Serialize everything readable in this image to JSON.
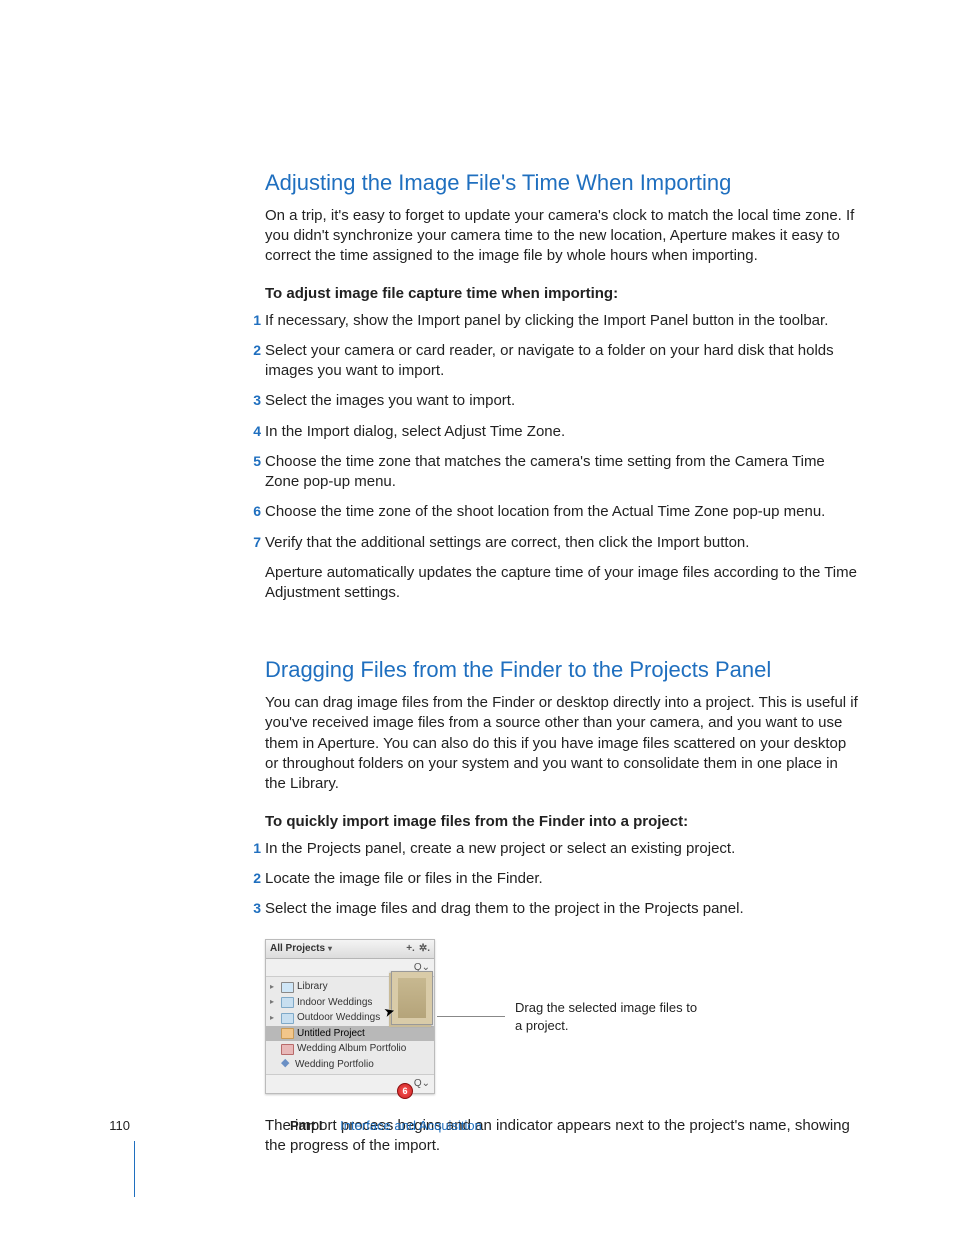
{
  "section1": {
    "heading": "Adjusting the Image File's Time When Importing",
    "intro": "On a trip, it's easy to forget to update your camera's clock to match the local time zone. If you didn't synchronize your camera time to the new location, Aperture makes it easy to correct the time assigned to the image file by whole hours when importing.",
    "lead": "To adjust image file capture time when importing:",
    "steps": [
      "If necessary, show the Import panel by clicking the Import Panel button in the toolbar.",
      "Select your camera or card reader, or navigate to a folder on your hard disk that holds images you want to import.",
      "Select the images you want to import.",
      "In the Import dialog, select Adjust Time Zone.",
      "Choose the time zone that matches the camera's time setting from the Camera Time Zone pop-up menu.",
      "Choose the time zone of the shoot location from the Actual Time Zone pop-up menu.",
      "Verify that the additional settings are correct, then click the Import button."
    ],
    "outro": "Aperture automatically updates the capture time of your image files according to the Time Adjustment settings."
  },
  "section2": {
    "heading": "Dragging Files from the Finder to the Projects Panel",
    "intro": "You can drag image files from the Finder or desktop directly into a project. This is useful if you've received image files from a source other than your camera, and you want to use them in Aperture. You can also do this if you have image files scattered on your desktop or throughout folders on your system and you want to consolidate them in one place in the Library.",
    "lead": "To quickly import image files from the Finder into a project:",
    "steps": [
      "In the Projects panel, create a new project or select an existing project.",
      "Locate the image file or files in the Finder.",
      "Select the image files and drag them to the project in the Projects panel."
    ],
    "outro": "The import process begins and an indicator appears next to the project's name, showing the progress of the import."
  },
  "figure": {
    "panel_title": "All Projects",
    "add_glyph": "+.",
    "gear_glyph": "✲.",
    "search_glyph": "Q⌄",
    "items": [
      {
        "label": "Library",
        "expandable": true,
        "iconName": "library-icon",
        "iconClass": "icon-box"
      },
      {
        "label": "Indoor Weddings",
        "expandable": true,
        "iconName": "folder-icon",
        "iconClass": "icon-folder"
      },
      {
        "label": "Outdoor Weddings",
        "expandable": true,
        "iconName": "folder-icon",
        "iconClass": "icon-folder"
      },
      {
        "label": "Untitled Project",
        "expandable": false,
        "selected": true,
        "iconName": "project-icon",
        "iconClass": "icon-folder orange"
      },
      {
        "label": "Wedding Album Portfolio",
        "expandable": false,
        "iconName": "book-icon",
        "iconClass": "icon-book"
      },
      {
        "label": "Wedding Portfolio",
        "expandable": false,
        "iconName": "web-icon",
        "iconClass": "icon-star",
        "glyph": "◆"
      }
    ],
    "badge": "6",
    "callout": "Drag the selected image files to a project."
  },
  "footer": {
    "page": "110",
    "part_label": "Part I",
    "part_title": "Interface and Acquisition"
  }
}
